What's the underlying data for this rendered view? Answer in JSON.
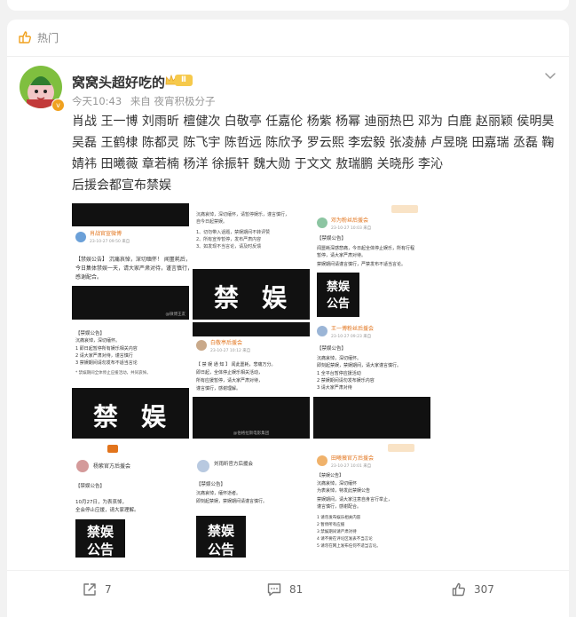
{
  "section": {
    "label": "热门"
  },
  "post": {
    "username": "窝窝头超好吃的",
    "vip_level": "Ⅱ",
    "avatar_badge": "v",
    "time": "今天10:43",
    "source": "来自 夜宵积极分子",
    "text_lines": [
      "肖战 王一博 刘雨昕 檀健次 白敬亭 任嘉伦 杨紫 杨幂 迪丽热巴 邓为 白鹿 赵丽颖 侯明昊",
      "吴磊 王鹤棣 陈都灵 陈飞宇 陈哲远 陈欣予 罗云熙 李宏毅 张凌赫 卢昱晓 田嘉瑞 丞磊 鞠",
      "婧祎 田曦薇 章若楠 杨洋 徐振轩 魏大勋 于文文 敖瑞鹏 关晓彤 李沁",
      "后援会都宣布禁娱"
    ]
  },
  "images": [
    {
      "header_name": "肖战官宣微博",
      "subtitle": "23-10-27 09:50 来自",
      "lines": [
        "【禁娱公告】 沉痛哀悼，深切缅怀！ 闻噩耗后，",
        "今日集体禁娱一天，请大家严肃对待，谨言慎行，",
        "感谢配合。"
      ],
      "big_text": [
        "",
        ""
      ],
      "watermark": "@微博王友"
    },
    {
      "header_name": "",
      "subtitle": "",
      "lines": [
        "沉痛哀悼，深切缅怀，请暂停娱乐，谨言慎行，",
        "自今日起禁娱。",
        "1、切勿带入话题，禁娱期间不转评赞",
        "2、所有宣传暂停，发布严肃内容",
        "3、如发现不当言论，请及时反馈"
      ],
      "big_text": [
        "禁",
        "娱"
      ],
      "watermark": ""
    },
    {
      "header_name": "邓为粉丝后援会",
      "subtitle": "23-10-27 10:03 来自",
      "lines": [
        "【禁娱公告】",
        "闻噩耗深感悲痛，今日起全体停止娱乐，所有行程",
        "暂停，请大家严肃对待。",
        "禁娱期间请谨言慎行，严禁发布不适当言论。"
      ],
      "big_text": [
        "禁娱",
        "公告"
      ],
      "watermark": ""
    },
    {
      "header_name": "",
      "subtitle": "",
      "lines": [
        "【禁娱公告】",
        "沉痛哀悼，深切缅怀。",
        "1 即日起暂停所有娱乐相关内容",
        "2 请大家严肃对待，谨言慎行",
        "3 禁娱期间请勿发布不适当言论",
        "* 禁娱期间全体停止应援活动，共同哀悼。"
      ],
      "big_text": [
        "禁",
        "娱"
      ],
      "watermark": ""
    },
    {
      "header_name": "白敬亭后援会",
      "subtitle": "23-10-27 10:12 来自",
      "lines": [
        "【 禁 娱 通 知 】 闻此噩耗，悲痛万分。",
        "即日起，全体停止娱乐相关活动，",
        "所有应援暂停，请大家严肃对待，",
        "谨言慎行，感谢理解。"
      ],
      "big_text": [
        "",
        ""
      ],
      "watermark": "@伯格拉斯电影集团"
    },
    {
      "header_name": "王一博粉丝后援会",
      "subtitle": "23-10-27 09:23 来自",
      "lines": [
        "【禁娱公告】",
        "沉痛哀悼，深切缅怀。",
        "即刻起禁娱，禁娱期间，请大家谨言慎行。",
        "1 全平台暂停应援活动",
        "2 禁娱期间请勿发布娱乐内容",
        "3 请大家严肃对待"
      ],
      "big_text": [
        "",
        ""
      ],
      "watermark": ""
    },
    {
      "header_name": "杨紫官方后援会",
      "subtitle": "",
      "lines": [
        "【禁娱公告】",
        "10月27日，为表哀悼，",
        "全会停止应援，请大家理解。"
      ],
      "big_text": [
        "禁娱",
        "公告"
      ],
      "watermark": ""
    },
    {
      "header_name": "刘雨昕官方后援会",
      "subtitle": "",
      "lines": [
        "【禁娱公告】",
        "沉痛哀悼，缅怀逝者。",
        "即刻起禁娱，禁娱期间请谨言慎行。"
      ],
      "big_text": [
        "禁娱",
        "公告"
      ],
      "watermark": ""
    },
    {
      "header_name": "田曦薇官方后援会",
      "subtitle": "23-10-27 10:01 来自",
      "lines": [
        "【禁娱公告】",
        "沉痛哀悼，深切缅怀",
        "为表哀悼，特发此禁娱公告",
        "禁娱期间，请大家注意自身言行举止，",
        "谨言慎行，感谢配合。",
        "1 请勿发布娱乐相关内容",
        "2 暂停所有应援",
        "3 禁娱期间请严肃对待",
        "4 请不要在评论区发表不当言论",
        "5 请勿在网上发布任何不适当言论。"
      ],
      "big_text": [
        "",
        ""
      ],
      "watermark": ""
    }
  ],
  "actions": {
    "repost_count": "7",
    "comment_count": "81",
    "like_count": "307"
  },
  "colors": {
    "accent": "#ff8200",
    "text": "#333333",
    "muted": "#999999",
    "vip_gold": "#f6c94b"
  }
}
